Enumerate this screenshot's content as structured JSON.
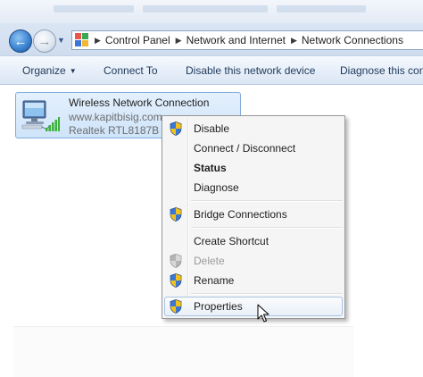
{
  "address_bar": {
    "breadcrumbs": [
      "Control Panel",
      "Network and Internet",
      "Network Connections"
    ]
  },
  "command_bar": {
    "organize": "Organize",
    "connect_to": "Connect To",
    "disable": "Disable this network device",
    "diagnose": "Diagnose this conn"
  },
  "connection": {
    "name": "Wireless Network Connection",
    "status": "www.kapitbisig.com",
    "adapter": "Realtek RTL8187B W"
  },
  "context_menu": {
    "items": [
      {
        "label": "Disable",
        "shield": true
      },
      {
        "label": "Connect / Disconnect",
        "shield": false
      },
      {
        "label": "Status",
        "shield": false,
        "bold": true
      },
      {
        "label": "Diagnose",
        "shield": false
      },
      {
        "label": "Bridge Connections",
        "shield": true
      },
      {
        "label": "Create Shortcut",
        "shield": false
      },
      {
        "label": "Delete",
        "shield": true,
        "disabled": true
      },
      {
        "label": "Rename",
        "shield": true
      },
      {
        "label": "Properties",
        "shield": true,
        "hover": true
      }
    ]
  },
  "icons": {
    "back": "back-arrow-icon",
    "forward": "forward-arrow-icon",
    "control_panel": "control-panel-icon",
    "network_adapter": "wireless-network-icon",
    "uac_shield": "uac-shield-icon",
    "cursor": "mouse-pointer-icon"
  },
  "colors": {
    "accent": "#3f86d4",
    "menu_hover_border": "#a8c4e6",
    "tile_selected": "#cfe4fa"
  }
}
